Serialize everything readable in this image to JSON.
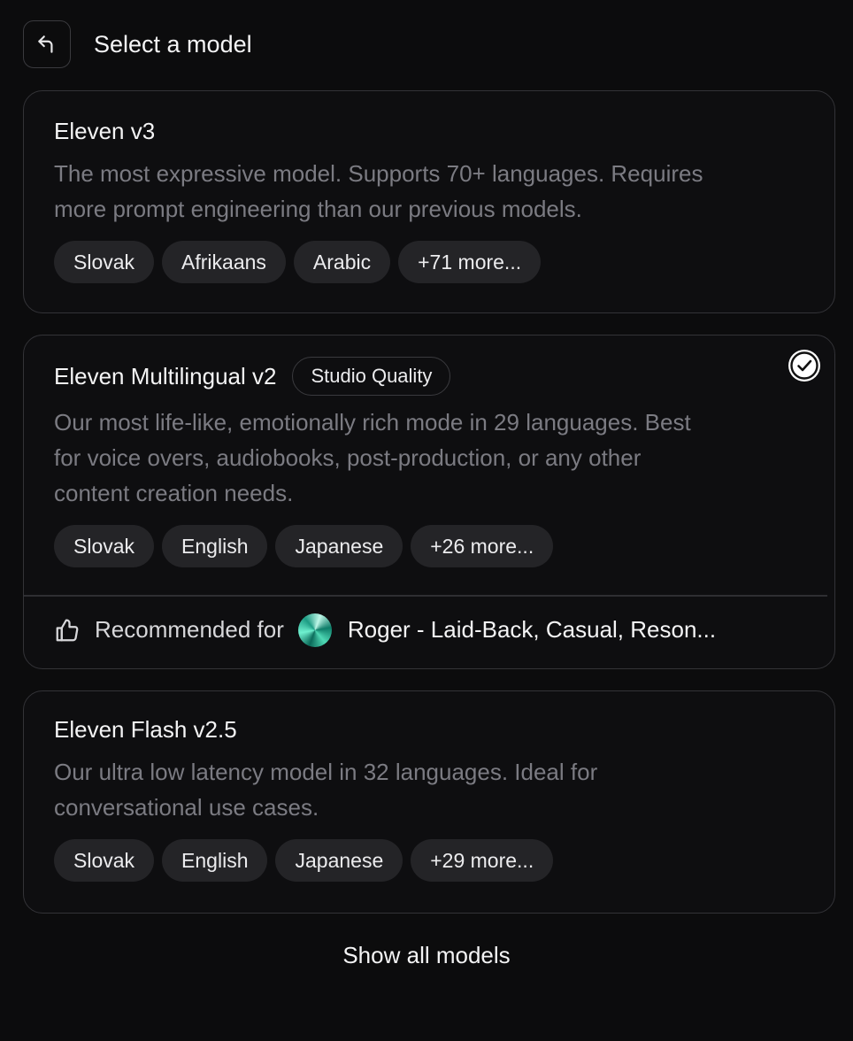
{
  "header": {
    "title": "Select a model",
    "back_icon": "undo-arrow-icon"
  },
  "models": [
    {
      "name": "Eleven v3",
      "badge": null,
      "description_lines": [
        "The most expressive model. Supports 70+ languages. Requires",
        "more prompt engineering than our previous models."
      ],
      "tags": [
        "Slovak",
        "Afrikaans",
        "Arabic",
        "+71 more..."
      ],
      "selected": false
    },
    {
      "name": "Eleven Multilingual v2",
      "badge": "Studio Quality",
      "description_lines": [
        "Our most life-like, emotionally rich mode in 29 languages. Best",
        "for voice overs, audiobooks, post-production, or any other",
        "content creation needs."
      ],
      "tags": [
        "Slovak",
        "English",
        "Japanese",
        "+26 more..."
      ],
      "selected": true,
      "recommended": {
        "label": "Recommended for",
        "voice": "Roger - Laid-Back, Casual, Reson..."
      }
    },
    {
      "name": "Eleven Flash v2.5",
      "badge": null,
      "description_lines": [
        "Our ultra low latency model in 32 languages. Ideal for",
        "conversational use cases."
      ],
      "tags": [
        "Slovak",
        "English",
        "Japanese",
        "+29 more..."
      ],
      "selected": false
    }
  ],
  "footer": {
    "show_all_label": "Show all models"
  }
}
